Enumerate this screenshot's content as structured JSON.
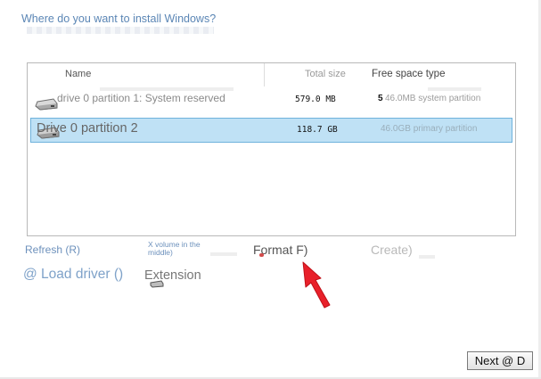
{
  "heading": "Where do you want to install Windows?",
  "table": {
    "columns": {
      "name": "Name",
      "total_size": "Total size",
      "free_space_type": "Free space type"
    },
    "rows": [
      {
        "name": "drive 0 partition 1: System reserved",
        "total_size": "579.0 MB",
        "free_prefix": "5",
        "free_space_type": "46.0MB system partition",
        "selected": false
      },
      {
        "name": "Drive 0 partition 2",
        "total_size": "118.7 GB",
        "free_space_type": "46.0GB primary partition",
        "selected": true
      }
    ]
  },
  "actions": {
    "refresh": "Refresh (R)",
    "x_volume": "X volume in the middle)",
    "format": "Format F)",
    "create": "Create)",
    "load_driver": "@ Load driver ()",
    "extension": "Extension"
  },
  "next_button": "Next @ D",
  "colors": {
    "selection": "#bfe1f5",
    "selection_border": "#6fb2dc",
    "link": "#6d91bc",
    "arrow": "#e8202a"
  },
  "icons": {
    "drive": "hard-drive-icon",
    "arrow": "red-arrow-pointer"
  }
}
